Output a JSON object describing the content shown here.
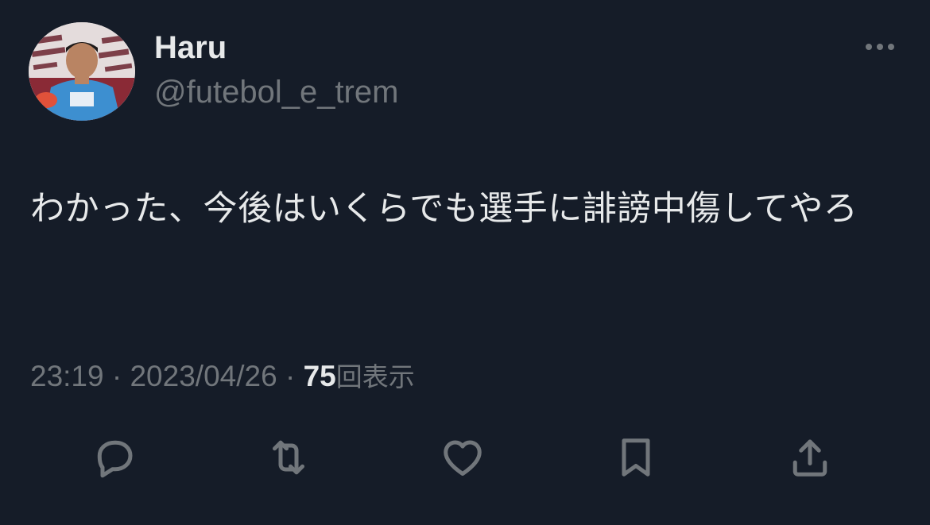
{
  "user": {
    "display_name": "Haru",
    "handle": "@futebol_e_trem"
  },
  "tweet": {
    "text": "わかった、今後はいくらでも選手に誹謗中傷してやろ"
  },
  "meta": {
    "time": "23:19",
    "separator": "·",
    "date": "2023/04/26",
    "views_count": "75",
    "views_label": "回表示"
  },
  "actions": [
    {
      "name": "reply",
      "icon": "speech-bubble-icon"
    },
    {
      "name": "retweet",
      "icon": "retweet-icon"
    },
    {
      "name": "like",
      "icon": "heart-icon"
    },
    {
      "name": "bookmark",
      "icon": "bookmark-icon"
    },
    {
      "name": "share",
      "icon": "share-icon"
    }
  ],
  "colors": {
    "background": "#151c28",
    "primary_text": "#e7e9ea",
    "secondary_text": "#71767b"
  }
}
